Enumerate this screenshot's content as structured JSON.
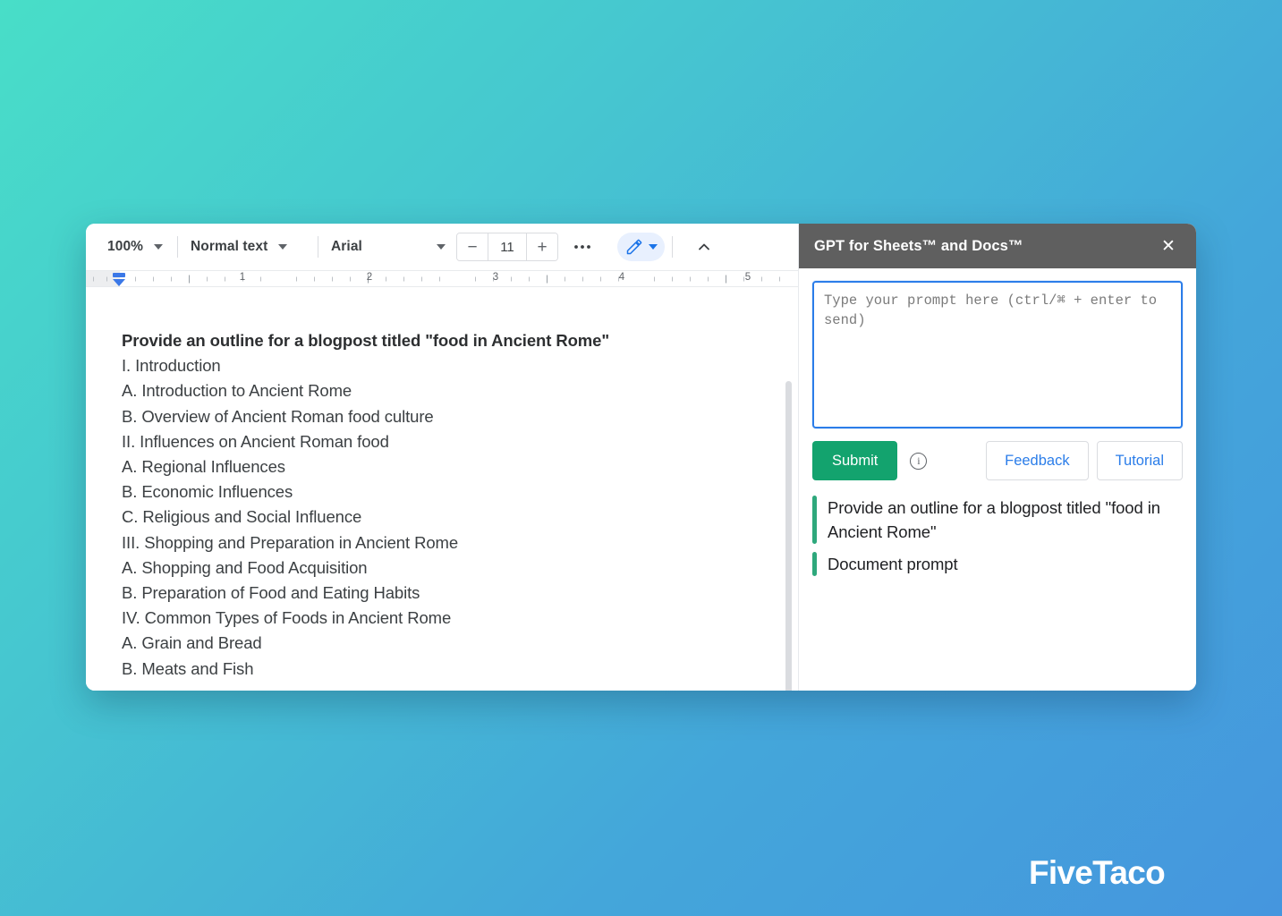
{
  "background": {
    "gradient_from": "#48DEC8",
    "gradient_to": "#4596DE"
  },
  "watermark": {
    "text": "FiveTaco"
  },
  "editor": {
    "toolbar": {
      "zoom": "100%",
      "paragraph_style": "Normal text",
      "font_family": "Arial",
      "font_size": "11",
      "decrease_label": "−",
      "increase_label": "+",
      "more_label": "…",
      "pencil_icon": "pencil-icon",
      "collapse_icon": "chevron-up-icon"
    },
    "ruler": {
      "numbers": [
        "1",
        "2",
        "3",
        "4",
        "5"
      ]
    },
    "document": {
      "title": "Provide an outline for a blogpost titled \"food in Ancient Rome\"",
      "lines": [
        "I. Introduction",
        "A. Introduction to Ancient Rome",
        "B. Overview of Ancient Roman food culture",
        "II. Influences on Ancient Roman food",
        "A. Regional Influences",
        "B. Economic Influences",
        "C. Religious and Social Influence",
        "III. Shopping and Preparation in Ancient Rome",
        "A. Shopping and Food Acquisition",
        "B. Preparation of Food and Eating Habits",
        "IV. Common Types of Foods in Ancient Rome",
        "A. Grain and Bread",
        "B. Meats and Fish"
      ]
    }
  },
  "panel": {
    "title": "GPT for Sheets™ and Docs™",
    "close_label": "✕",
    "prompt": {
      "value": "",
      "placeholder": "Type your prompt here (ctrl/⌘ + enter to send)"
    },
    "buttons": {
      "submit": "Submit",
      "info_label": "i",
      "feedback": "Feedback",
      "tutorial": "Tutorial"
    },
    "accent_color": "#2EA87C",
    "history": [
      {
        "text": "Provide an outline for a blogpost titled \"food in Ancient Rome\""
      },
      {
        "text": "Document prompt"
      }
    ]
  }
}
